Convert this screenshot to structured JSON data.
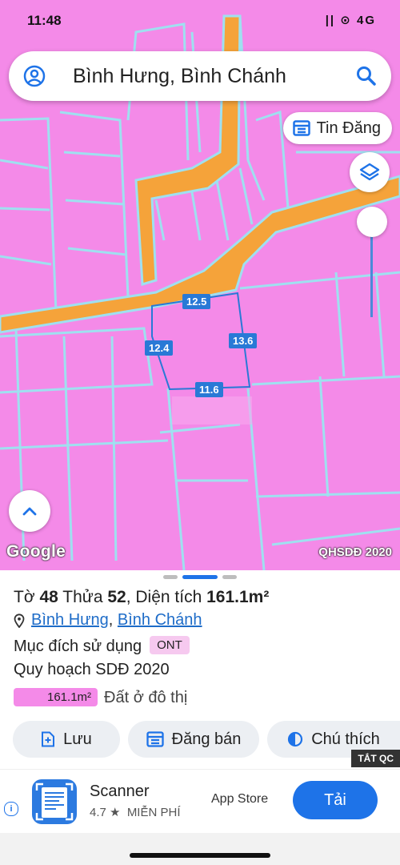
{
  "status_bar": {
    "time": "11:48",
    "indicators": "|| ⊙ 4G"
  },
  "search": {
    "query": "Bình Hưng, Bình Chánh"
  },
  "map": {
    "listing_button_label": "Tin Đăng",
    "dimensions": {
      "top": "12.5",
      "left": "12.4",
      "right": "13.6",
      "bottom": "11.6"
    },
    "provider_logo": "Google",
    "layer_label": "QHSDĐ 2020",
    "colors": {
      "land": "#f48ae8",
      "road": "#f5a33a",
      "boundary": "#9fe0f0",
      "selection": "#2979d6"
    }
  },
  "parcel": {
    "title_prefix": "Tờ ",
    "sheet_no": "48",
    "plot_label": " Thửa ",
    "plot_no": "52",
    "area_label": ", Diện tích ",
    "area_value": "161.1m²",
    "ward": "Bình Hưng",
    "separator": ", ",
    "district": "Bình Chánh",
    "purpose_label": "Mục đích sử dụng",
    "purpose_code": "ONT",
    "plan_label": "Quy hoạch SDĐ 2020",
    "plan_area": "161.1m²",
    "plan_type": "Đất ở đô thị"
  },
  "actions": {
    "save": "Lưu",
    "post_sale": "Đăng bán",
    "legend": "Chú thích"
  },
  "ad": {
    "close_label": "TẮT QC",
    "app_name": "Scanner",
    "rating": "4.7 ★",
    "price": "MIỄN PHÍ",
    "store": "App Store",
    "install": "Tải"
  }
}
